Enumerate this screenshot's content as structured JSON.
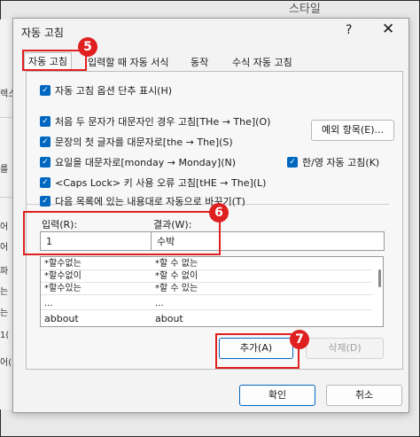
{
  "background": {
    "title": "스타일",
    "left_glyphs": [
      "렉스",
      "를",
      "어",
      "어",
      "파",
      "는",
      "는",
      "1(",
      "어("
    ]
  },
  "dialog": {
    "title": "자동 고침",
    "help": "?",
    "close": "✕"
  },
  "tabs": [
    {
      "label": "자동 고침"
    },
    {
      "label": "입력할 때 자동 서식"
    },
    {
      "label": "동작"
    },
    {
      "label": "수식 자동 고침"
    }
  ],
  "options": {
    "show_buttons": "자동 고침 옵션 단추 표시(H)",
    "two_initial_caps": "처음 두 문자가 대문자인 경우 고침[THe → The](O)",
    "first_letter_sentence": "문장의 첫 글자를 대문자로[the → The](S)",
    "day_names": "요일을 대문자로[monday → Monday](N)",
    "caps_lock": "<Caps Lock> 키 사용 오류 고침[tHE → The](L)",
    "replace_as_you_type": "다음 목록에 있는 내용대로 자동으로 바꾸기(T)",
    "korean_english": "한/영 자동 고침(K)",
    "exceptions_button": "예외 항목(E)..."
  },
  "replace": {
    "label": "입력(R):",
    "value": "1"
  },
  "with": {
    "label": "결과(W):",
    "value": "수박"
  },
  "list_rows": [
    {
      "replace": "*할수없는",
      "with": "*할 수 없는"
    },
    {
      "replace": "*할수없이",
      "with": "*할 수 없이"
    },
    {
      "replace": "*할수있는",
      "with": "*할 수 있는"
    },
    {
      "replace": "...",
      "with": "..."
    },
    {
      "replace": "abbout",
      "with": "about"
    }
  ],
  "buttons": {
    "add": "추가(A)",
    "delete": "삭제(D)",
    "ok": "확인",
    "cancel": "취소"
  },
  "annotations": {
    "badge_5": "5",
    "badge_6": "6",
    "badge_7": "7",
    "color": "#e02020"
  }
}
